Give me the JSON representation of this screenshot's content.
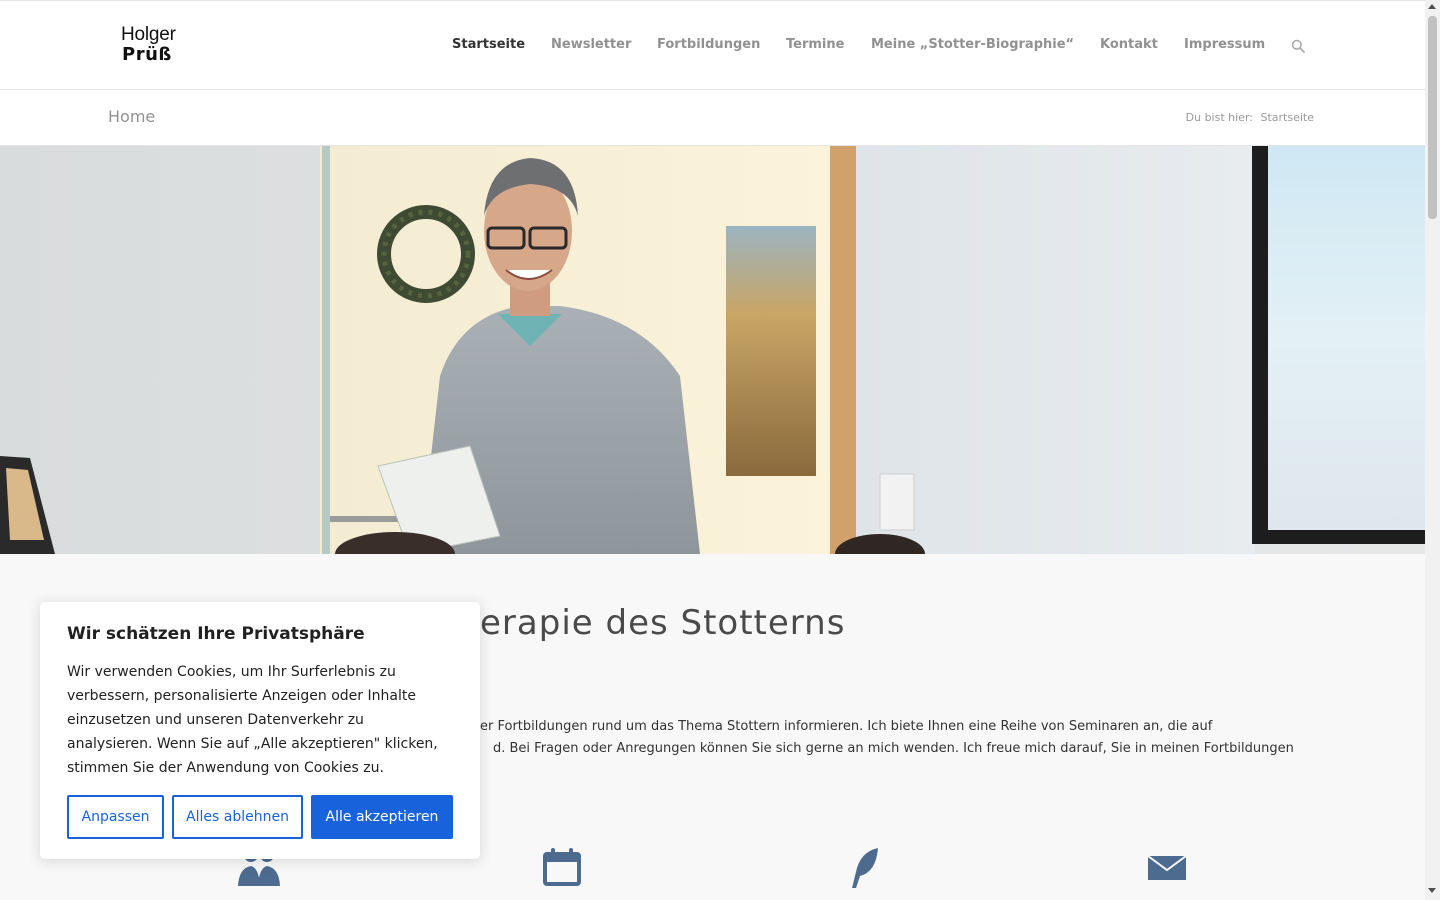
{
  "logo": {
    "line1": "Holger",
    "line2": "Prüß"
  },
  "nav": {
    "items": [
      {
        "label": "Startseite"
      },
      {
        "label": "Newsletter"
      },
      {
        "label": "Fortbildungen"
      },
      {
        "label": "Termine"
      },
      {
        "label": "Meine „Stotter-Biographie“"
      },
      {
        "label": "Kontakt"
      },
      {
        "label": "Impressum"
      }
    ],
    "search_icon": "search-icon"
  },
  "titlebar": {
    "title": "Home",
    "breadcrumb_prefix": "Du bist hier:",
    "breadcrumb_current": "Startseite"
  },
  "content": {
    "heading_visible": "erapie des Stotterns",
    "paragraph_line1": "er Fortbildungen rund um das Thema Stottern informieren. Ich biete Ihnen eine Reihe von Seminaren an, die auf",
    "paragraph_line2": "d. Bei Fragen oder Anregungen können Sie sich gerne an mich wenden. Ich freue mich darauf, Sie in meinen Fortbildungen",
    "feature_icons": [
      "users-icon",
      "calendar-icon",
      "feather-icon",
      "envelope-icon"
    ],
    "icon_color": "#4c6b8f"
  },
  "cookie": {
    "title": "Wir schätzen Ihre Privatsphäre",
    "text_lines": [
      "Wir verwenden Cookies, um Ihr Surferlebnis zu",
      "verbessern, personalisierte Anzeigen oder Inhalte",
      "einzusetzen und unseren Datenverkehr zu",
      "analysieren. Wenn Sie auf „Alle akzeptieren\" klicken,",
      "stimmen Sie der Anwendung von Cookies zu."
    ],
    "btn_customize": "Anpassen",
    "btn_reject": "Alles ablehnen",
    "btn_accept": "Alle akzeptieren",
    "accent_color": "#1863dc"
  }
}
